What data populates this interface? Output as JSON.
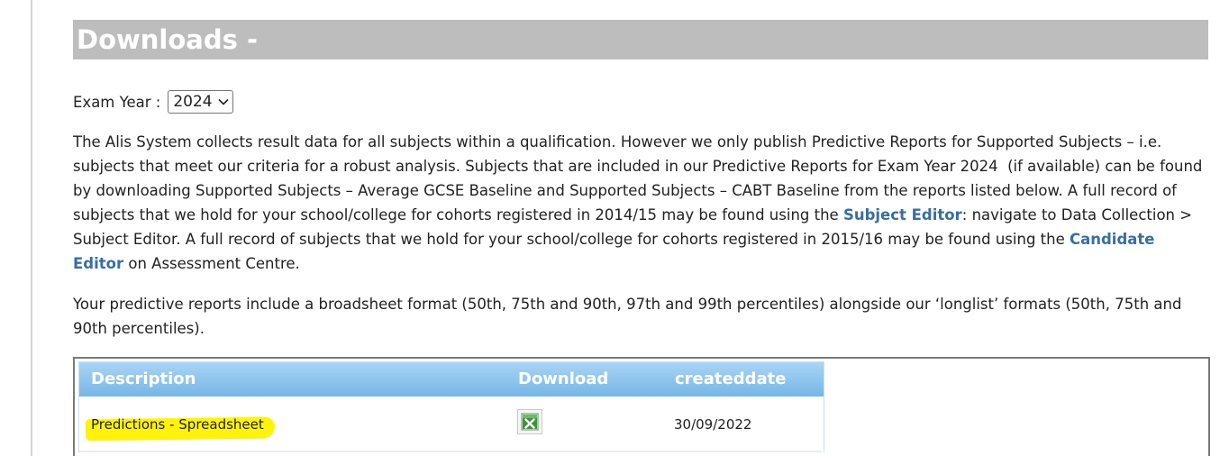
{
  "header": {
    "title": "Downloads -"
  },
  "exam_year": {
    "label": "Exam Year :",
    "selected": "2024"
  },
  "intro": {
    "p1_part1": "The Alis System collects result data for all subjects within a qualification. However we only publish Predictive Reports for Supported Subjects – i.e. subjects that meet our criteria for a robust analysis. Subjects that are included in our Predictive Reports for Exam Year 2024  (if available) can be found by downloading Supported Subjects – Average GCSE Baseline and Supported Subjects – CABT Baseline from the reports listed below. A full record of subjects that we hold for your school/college for cohorts registered in 2014/15 may be found using the ",
    "subject_editor_link": "Subject Editor",
    "p1_part2": ": navigate to Data Collection > Subject Editor. A full record of subjects that we hold for your school/college for cohorts registered in 2015/16 may be found using the ",
    "candidate_editor_link": "Candidate Editor",
    "p1_part3": " on Assessment Centre.",
    "p2": "Your predictive reports include a broadsheet format (50th, 75th and 90th, 97th and 99th percentiles) alongside our ‘longlist’ formats (50th, 75th and 90th percentiles)."
  },
  "table": {
    "columns": [
      "Description",
      "Download",
      "createddate"
    ],
    "rows": [
      {
        "description": "Predictions - Spreadsheet",
        "download_icon": "excel-file-icon",
        "createddate": "30/09/2022"
      }
    ]
  },
  "colors": {
    "title_bar": "#bdbdbd",
    "link": "#3a6e9f",
    "table_header": "#77b6e6",
    "highlight": "#fff200"
  }
}
